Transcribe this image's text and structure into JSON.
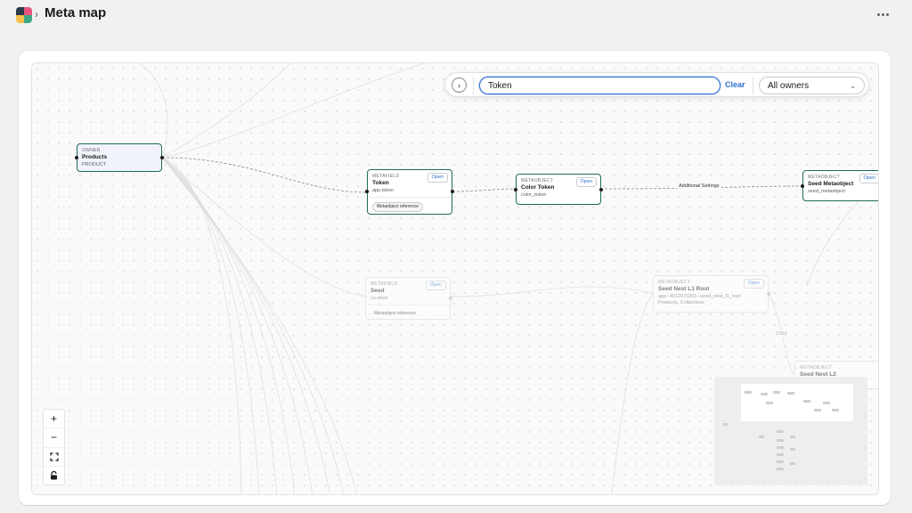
{
  "header": {
    "title": "Meta map"
  },
  "search": {
    "value": "Token",
    "clear_label": "Clear",
    "owner_filter": "All owners"
  },
  "nodes": {
    "owner_products": {
      "type": "OWNER",
      "name": "Products",
      "key": "PRODUCT"
    },
    "mf_token": {
      "type": "METAFIELD",
      "name": "Token",
      "key": "app.token",
      "tag": "Metaobject reference",
      "open_label": "Open"
    },
    "mo_color_token": {
      "type": "METAOBJECT",
      "name": "Color Token",
      "key": "color_token",
      "open_label": "Open"
    },
    "mo_seed": {
      "type": "METAOBJECT",
      "name": "Seed Metaobject",
      "key": "seed_metaobject",
      "open_label": "Open"
    },
    "mf_seed": {
      "type": "METAFIELD",
      "name": "Seed",
      "key": "cu.seed",
      "tag": "Metaobject reference",
      "open_label": "Open"
    },
    "mo_seed_nest_l1": {
      "type": "METAOBJECT",
      "name": "Seed Nest L1 Root",
      "key": "app--4012670201--seed_nest_l1_root",
      "owners": "Products, Collections",
      "open_label": "Open"
    },
    "mo_seed_nest_l2": {
      "type": "METAOBJECT",
      "name": "Seed Nest L2"
    }
  },
  "edge_labels": {
    "additional_settings": "Additional Settings",
    "child": "Child"
  },
  "colors": {
    "accent": "#2c6ecb",
    "node_border": "#1f6b58",
    "owner_bg": "#f0f3fa"
  },
  "icons": {
    "expand": "chevron-right-icon",
    "select": "chevron-down-icon",
    "more": "ellipsis-icon"
  }
}
